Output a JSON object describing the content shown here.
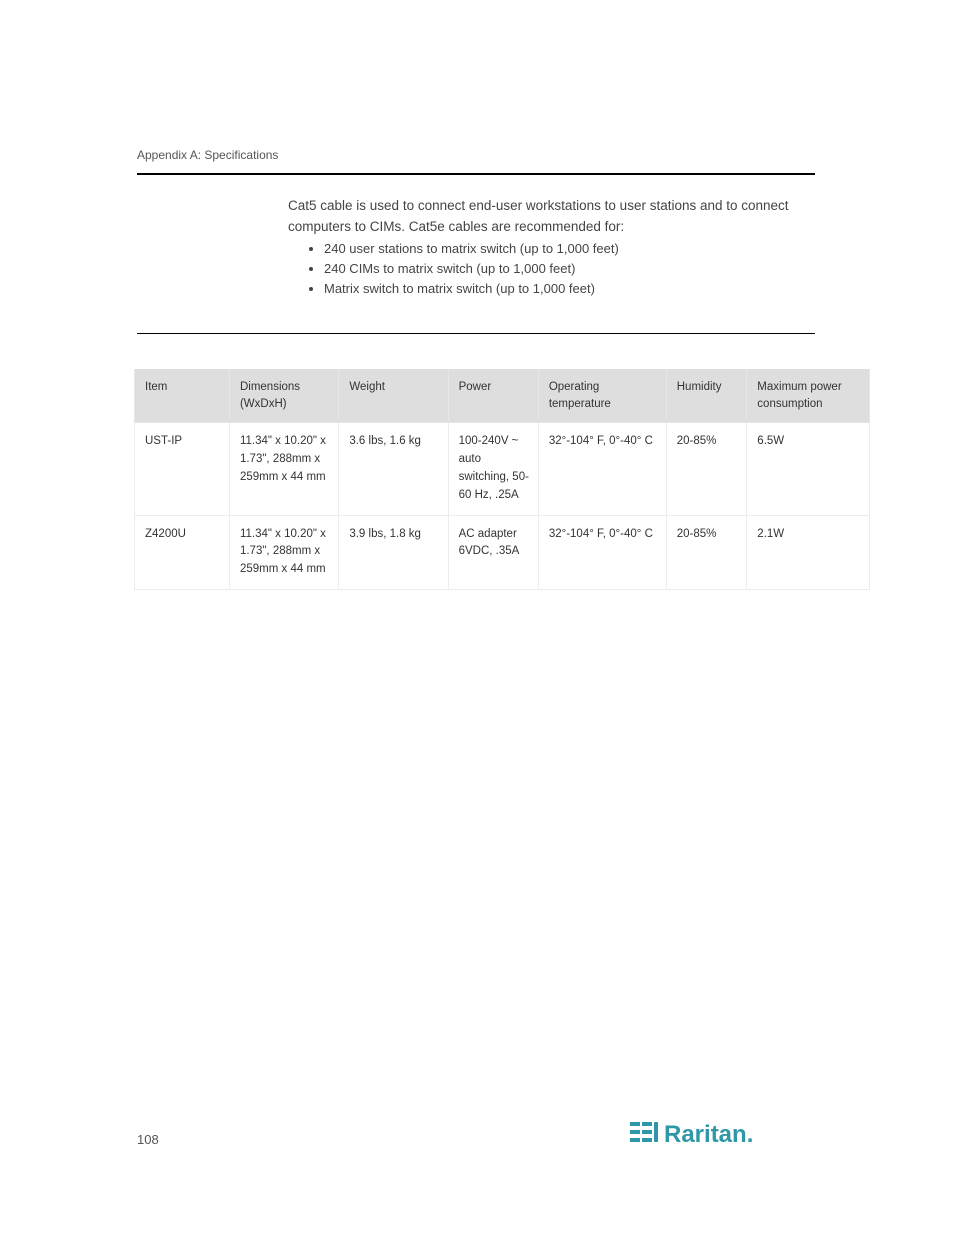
{
  "document": {
    "appendix_label": "Appendix A: Specifications",
    "intro": "Cat5 cable is used to connect end-user workstations to user stations and to connect computers to CIMs. Cat5e cables are recommended for:",
    "bullets": [
      "240 user stations to matrix switch (up to 1,000 feet)",
      "240 CIMs to matrix switch (up to 1,000 feet)",
      "Matrix switch to matrix switch (up to 1,000 feet)"
    ]
  },
  "table": {
    "headers": [
      "Item",
      "Dimensions (WxDxH)",
      "Weight",
      "Power",
      "Operating temperature",
      "Humidity",
      "Maximum power consumption"
    ],
    "rows": [
      {
        "item": "UST-IP",
        "dimensions": "11.34\" x 10.20\" x 1.73\", 288mm x 259mm x 44 mm",
        "weight": "3.6 lbs, 1.6 kg",
        "power": "100-240V ~ auto switching, 50-60 Hz, .25A",
        "temperature": "32°-104° F, 0°-40° C",
        "humidity": "20-85%",
        "max_power": "6.5W"
      },
      {
        "item": "Z4200U",
        "dimensions": "11.34\" x 10.20\" x 1.73\", 288mm x 259mm x 44 mm",
        "weight": "3.9 lbs, 1.8 kg",
        "power": "AC adapter 6VDC, .35A",
        "temperature": "32°-104° F, 0°-40° C",
        "humidity": "20-85%",
        "max_power": "2.1W"
      }
    ]
  },
  "footer": {
    "page_number": "108"
  },
  "brand": {
    "name": "Raritan.",
    "color": "#2f97a8"
  }
}
